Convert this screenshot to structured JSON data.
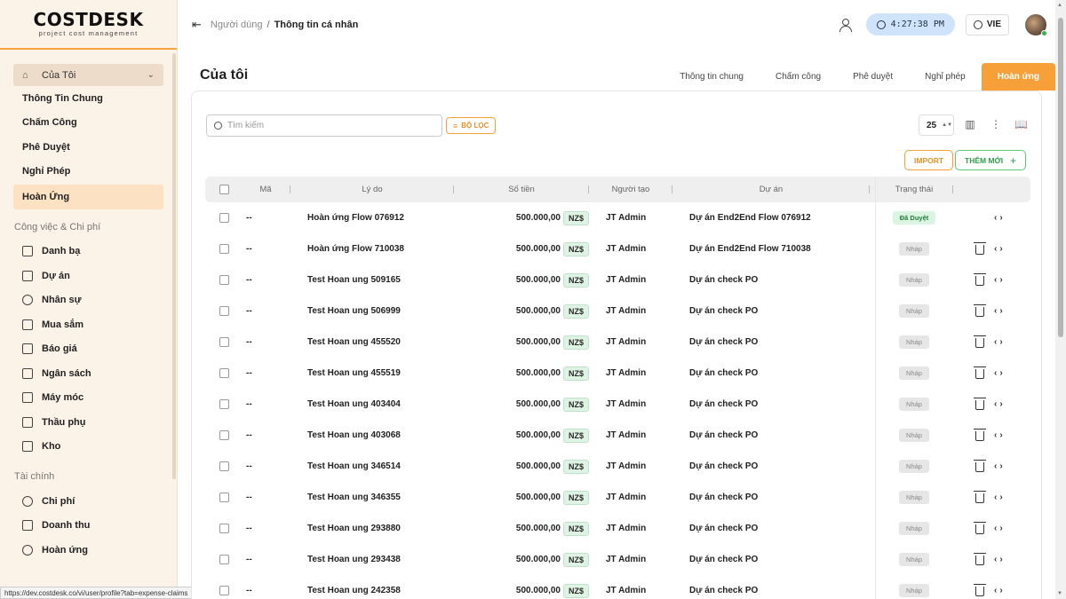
{
  "logo": {
    "title": "COSTDESK",
    "subtitle": "project cost management"
  },
  "sidebar": {
    "parent": {
      "label": "Của Tôi",
      "icon": "home-icon"
    },
    "sub_items": [
      {
        "label": "Thông Tin Chung",
        "active": false
      },
      {
        "label": "Chấm Công",
        "active": false
      },
      {
        "label": "Phê Duyệt",
        "active": false
      },
      {
        "label": "Nghỉ Phép",
        "active": false
      },
      {
        "label": "Hoàn Ứng",
        "active": true
      }
    ],
    "sections": [
      {
        "title": "Công việc & Chi phí",
        "items": [
          {
            "label": "Danh bạ",
            "icon": "contacts-icon"
          },
          {
            "label": "Dự án",
            "icon": "project-icon"
          },
          {
            "label": "Nhân sự",
            "icon": "people-icon"
          },
          {
            "label": "Mua sắm",
            "icon": "cart-icon"
          },
          {
            "label": "Báo giá",
            "icon": "quote-icon"
          },
          {
            "label": "Ngân sách",
            "icon": "budget-icon"
          },
          {
            "label": "Máy móc",
            "icon": "machine-icon"
          },
          {
            "label": "Thầu phụ",
            "icon": "subcontractor-icon"
          },
          {
            "label": "Kho",
            "icon": "warehouse-icon"
          }
        ]
      },
      {
        "title": "Tài chính",
        "items": [
          {
            "label": "Chi phí",
            "icon": "expense-icon"
          },
          {
            "label": "Doanh thu",
            "icon": "revenue-icon"
          },
          {
            "label": "Hoàn ứng",
            "icon": "refund-icon"
          }
        ]
      }
    ],
    "status_url": "https://dev.costdesk.co/vi/user/profile?tab=expense-claims"
  },
  "header": {
    "breadcrumb_parent": "Người dùng",
    "breadcrumb_sep": "/",
    "breadcrumb_current": "Thông tin cá nhân",
    "clock": "4:27:38 PM",
    "language": "VIE"
  },
  "main": {
    "title": "Của tôi",
    "tabs": [
      {
        "label": "Thông tin chung",
        "active": false
      },
      {
        "label": "Chấm công",
        "active": false
      },
      {
        "label": "Phê duyệt",
        "active": false
      },
      {
        "label": "Nghỉ phép",
        "active": false
      },
      {
        "label": "Hoàn ứng",
        "active": true
      }
    ],
    "search_placeholder": "Tìm kiếm",
    "filter_label": "BỘ LỌC",
    "page_size": "25",
    "import_label": "IMPORT",
    "new_label": "THÊM MỚI",
    "columns": {
      "code": "Mã",
      "reason": "Lý do",
      "amount": "Số tiền",
      "creator": "Người tạo",
      "project": "Dự án",
      "status": "Trạng thái"
    },
    "rows": [
      {
        "code": "--",
        "reason": "Hoàn ứng Flow 076912",
        "amount": "500.000,00",
        "currency": "NZ$",
        "creator": "JT Admin",
        "project": "Dự án End2End Flow 076912",
        "status": "Đã Duyệt",
        "status_type": "approved",
        "deletable": false
      },
      {
        "code": "--",
        "reason": "Hoàn ứng Flow 710038",
        "amount": "500.000,00",
        "currency": "NZ$",
        "creator": "JT Admin",
        "project": "Dự án End2End Flow 710038",
        "status": "Nháp",
        "status_type": "draft",
        "deletable": true
      },
      {
        "code": "--",
        "reason": "Test Hoan ung 509165",
        "amount": "500.000,00",
        "currency": "NZ$",
        "creator": "JT Admin",
        "project": "Dự án check PO",
        "status": "Nháp",
        "status_type": "draft",
        "deletable": true
      },
      {
        "code": "--",
        "reason": "Test Hoan ung 506999",
        "amount": "500.000,00",
        "currency": "NZ$",
        "creator": "JT Admin",
        "project": "Dự án check PO",
        "status": "Nháp",
        "status_type": "draft",
        "deletable": true
      },
      {
        "code": "--",
        "reason": "Test Hoan ung 455520",
        "amount": "500.000,00",
        "currency": "NZ$",
        "creator": "JT Admin",
        "project": "Dự án check PO",
        "status": "Nháp",
        "status_type": "draft",
        "deletable": true
      },
      {
        "code": "--",
        "reason": "Test Hoan ung 455519",
        "amount": "500.000,00",
        "currency": "NZ$",
        "creator": "JT Admin",
        "project": "Dự án check PO",
        "status": "Nháp",
        "status_type": "draft",
        "deletable": true
      },
      {
        "code": "--",
        "reason": "Test Hoan ung 403404",
        "amount": "500.000,00",
        "currency": "NZ$",
        "creator": "JT Admin",
        "project": "Dự án check PO",
        "status": "Nháp",
        "status_type": "draft",
        "deletable": true
      },
      {
        "code": "--",
        "reason": "Test Hoan ung 403068",
        "amount": "500.000,00",
        "currency": "NZ$",
        "creator": "JT Admin",
        "project": "Dự án check PO",
        "status": "Nháp",
        "status_type": "draft",
        "deletable": true
      },
      {
        "code": "--",
        "reason": "Test Hoan ung 346514",
        "amount": "500.000,00",
        "currency": "NZ$",
        "creator": "JT Admin",
        "project": "Dự án check PO",
        "status": "Nháp",
        "status_type": "draft",
        "deletable": true
      },
      {
        "code": "--",
        "reason": "Test Hoan ung 346355",
        "amount": "500.000,00",
        "currency": "NZ$",
        "creator": "JT Admin",
        "project": "Dự án check PO",
        "status": "Nháp",
        "status_type": "draft",
        "deletable": true
      },
      {
        "code": "--",
        "reason": "Test Hoan ung 293880",
        "amount": "500.000,00",
        "currency": "NZ$",
        "creator": "JT Admin",
        "project": "Dự án check PO",
        "status": "Nháp",
        "status_type": "draft",
        "deletable": true
      },
      {
        "code": "--",
        "reason": "Test Hoan ung 293438",
        "amount": "500.000,00",
        "currency": "NZ$",
        "creator": "JT Admin",
        "project": "Dự án check PO",
        "status": "Nháp",
        "status_type": "draft",
        "deletable": true
      },
      {
        "code": "--",
        "reason": "Test Hoan ung 242358",
        "amount": "500.000,00",
        "currency": "NZ$",
        "creator": "JT Admin",
        "project": "Dự án check PO",
        "status": "Nháp",
        "status_type": "draft",
        "deletable": true
      }
    ]
  },
  "colors": {
    "accent": "#f7a03a",
    "sidebar_bg": "#fbf2e8",
    "approved": "#1f7a3a",
    "new_button": "#2e9e4b"
  }
}
